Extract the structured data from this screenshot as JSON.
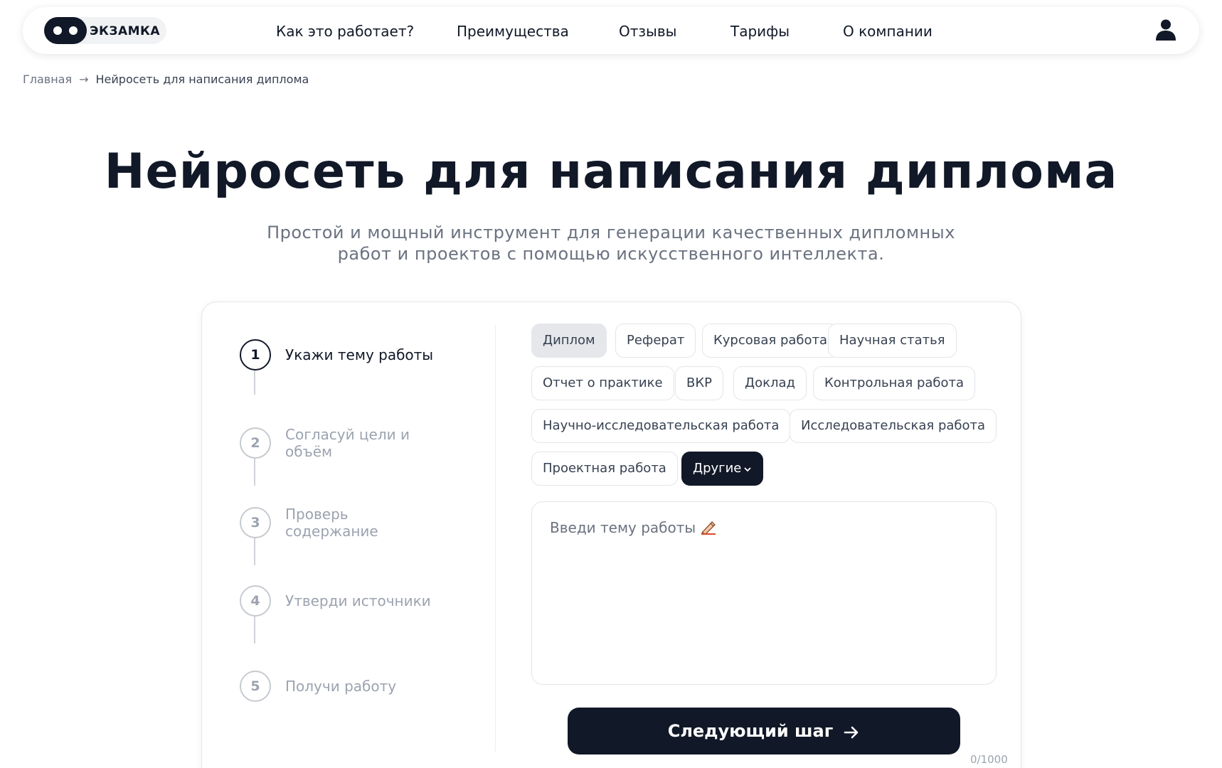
{
  "header": {
    "logo_text": "ЭКЗАМКА",
    "nav": [
      "Как это работает?",
      "Преимущества",
      "Отзывы",
      "Тарифы",
      "О компании"
    ],
    "user_icon": "user-icon"
  },
  "breadcrumb": {
    "home": "Главная",
    "separator": "→",
    "current": "Нейросеть для написания диплома"
  },
  "hero": {
    "title": "Нейросеть для написания диплома",
    "subtitle_line1": "Простой и мощный инструмент для генерации качественных дипломных",
    "subtitle_line2": "работ и проектов с помощью искусственного интеллекта."
  },
  "steps": [
    {
      "number": "1",
      "label": "Укажи тему работы",
      "active": true
    },
    {
      "number": "2",
      "label": "Согласуй цели и объём",
      "active": false
    },
    {
      "number": "3",
      "label": "Проверь содержание",
      "active": false
    },
    {
      "number": "4",
      "label": "Утверди источники",
      "active": false
    },
    {
      "number": "5",
      "label": "Получи работу",
      "active": false
    }
  ],
  "work_types": {
    "selected": "Диплом",
    "items": [
      "Диплом",
      "Реферат",
      "Курсовая работа",
      "Научная статья",
      "Отчет о практике",
      "ВКР",
      "Доклад",
      "Контрольная работа",
      "Научно-исследовательская работа",
      "Исследовательская работа",
      "Проектная работа"
    ],
    "more_label": "Другие"
  },
  "topic": {
    "placeholder": "Введи тему работы",
    "icon": "writing-hand-icon",
    "counter": "0/1000"
  },
  "next_button": {
    "label": "Следующий шаг",
    "icon": "arrow-right-icon"
  },
  "colors": {
    "primary": "#111827",
    "muted": "#9ca3af",
    "chip_selected": "#e5e7eb"
  }
}
